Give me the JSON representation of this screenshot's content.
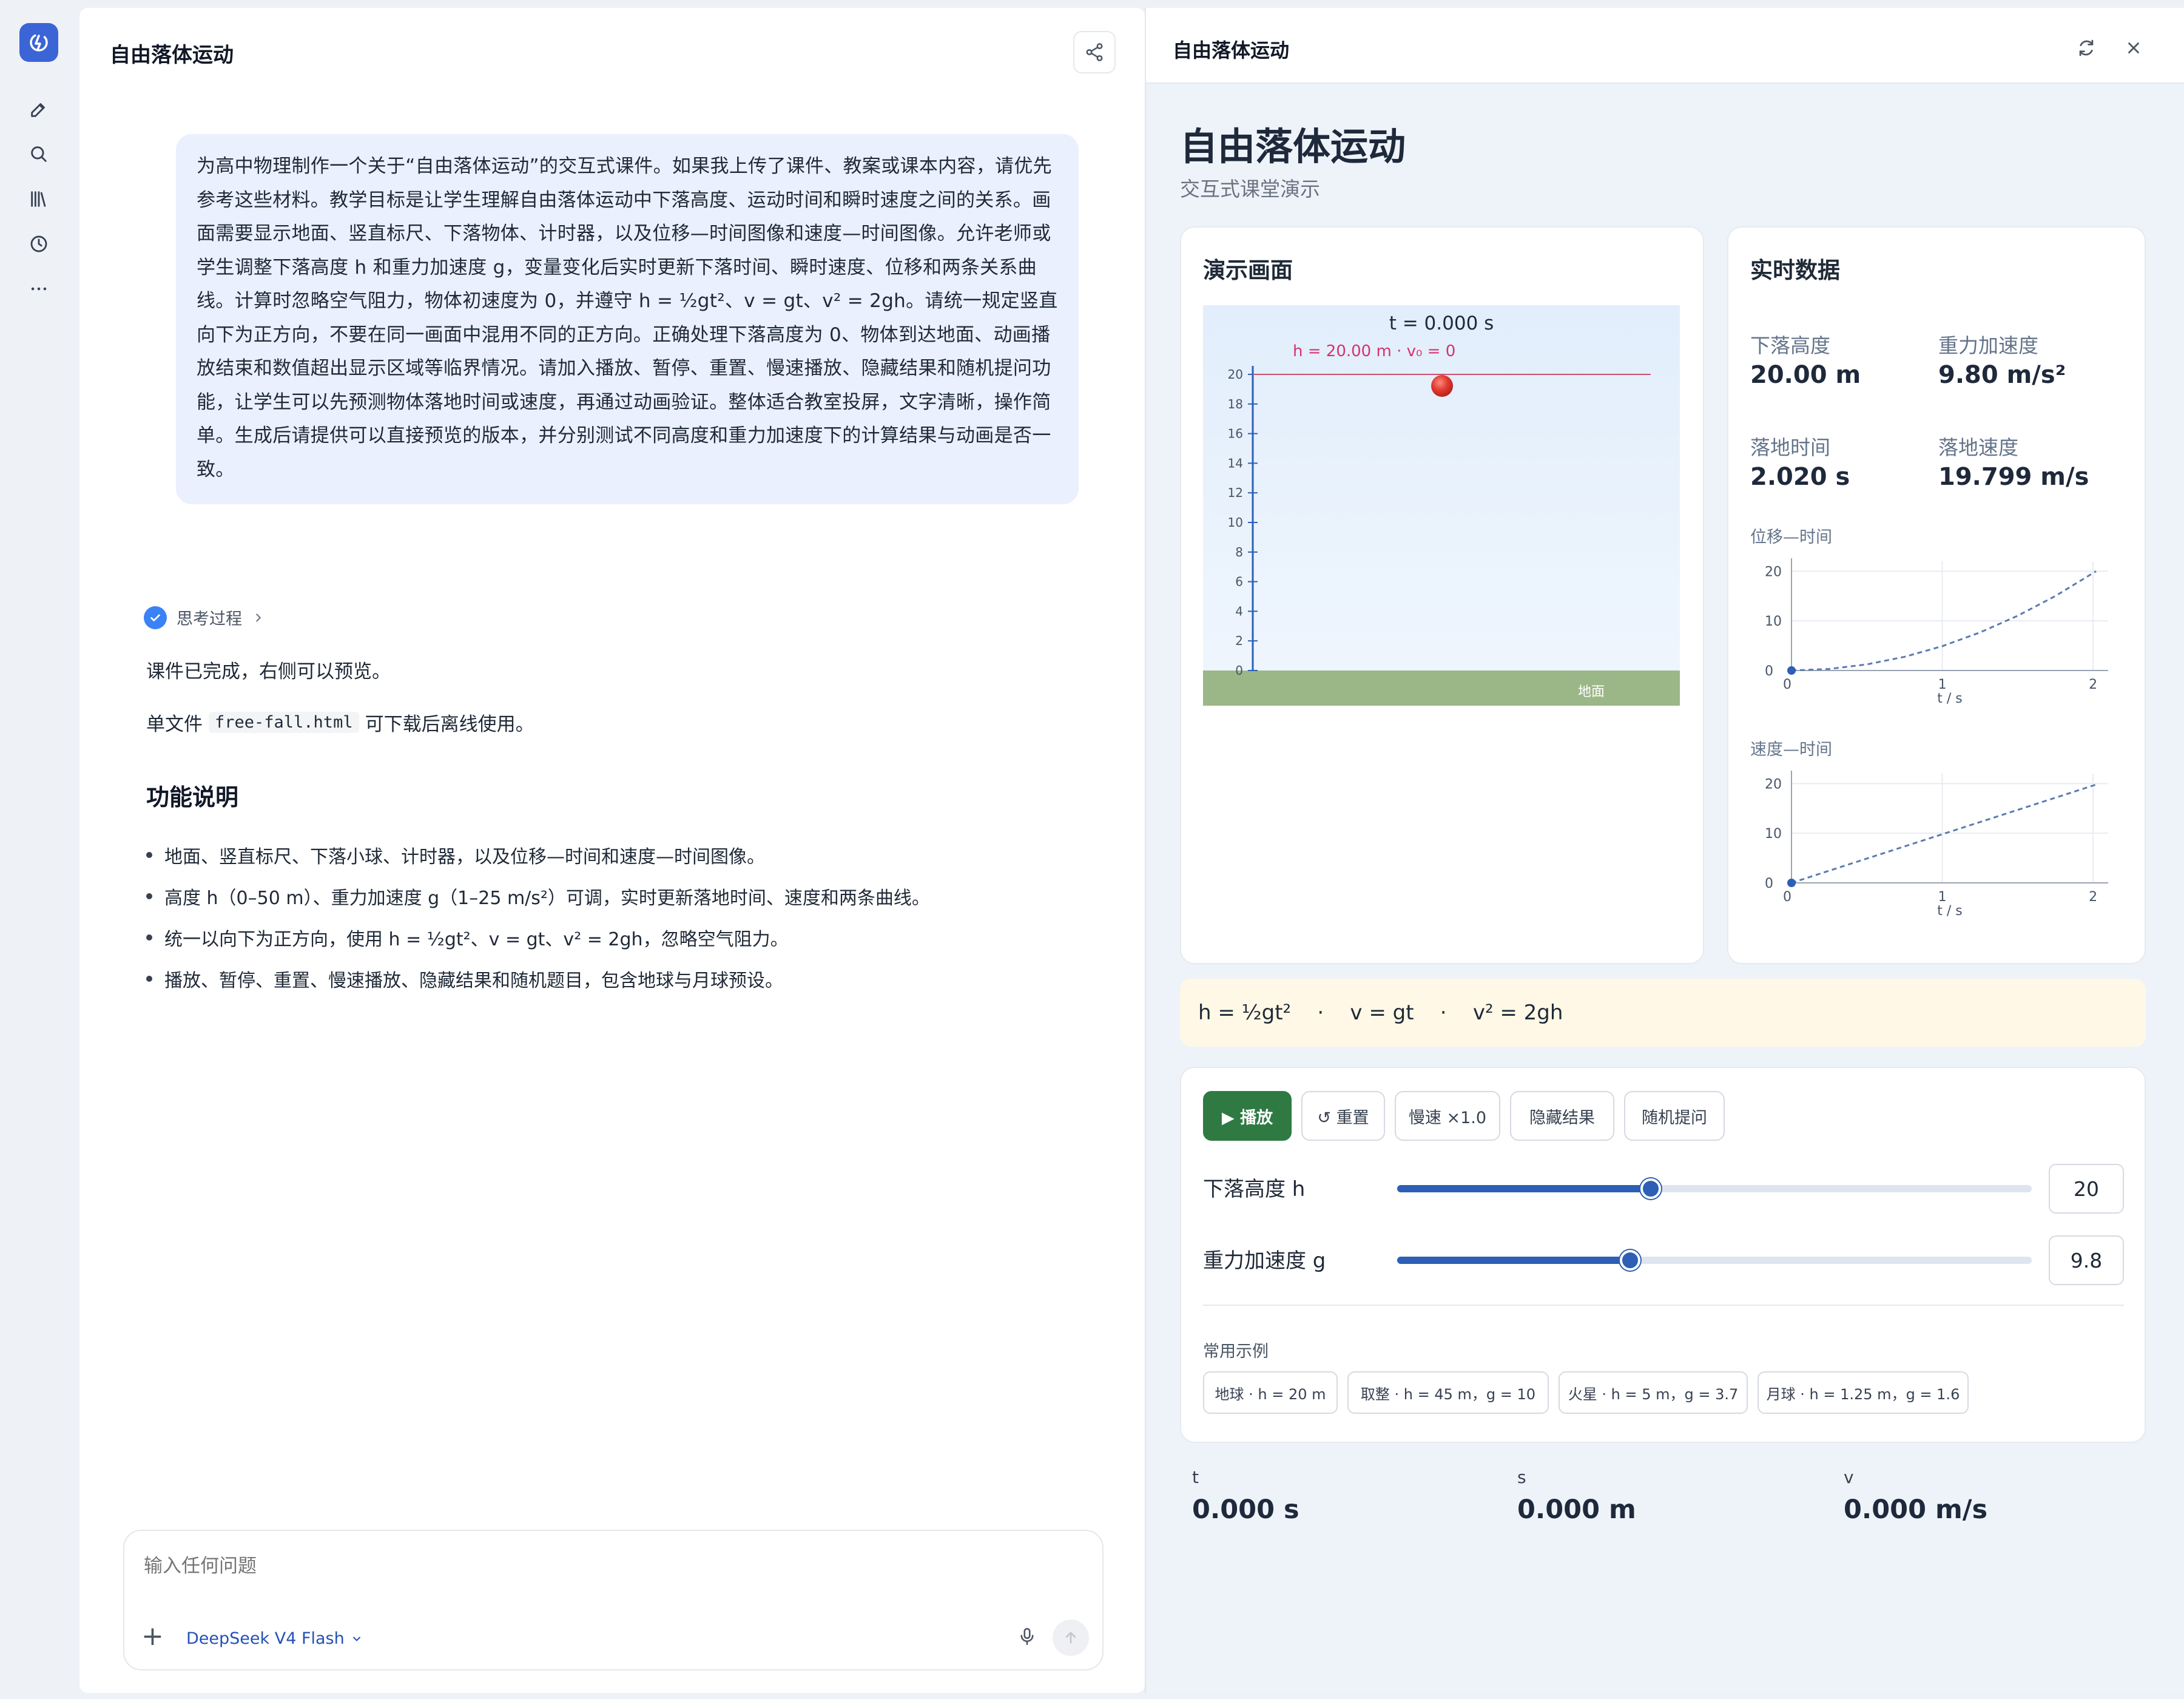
{
  "chat": {
    "title": "自由落体运动",
    "user_message": "为高中物理制作一个关于“自由落体运动”的交互式课件。如果我上传了课件、教案或课本内容，请优先参考这些材料。教学目标是让学生理解自由落体运动中下落高度、运动时间和瞬时速度之间的关系。画面需要显示地面、竖直标尺、下落物体、计时器，以及位移—时间图像和速度—时间图像。允许老师或学生调整下落高度 h 和重力加速度 g，变量变化后实时更新下落时间、瞬时速度、位移和两条关系曲线。计算时忽略空气阻力，物体初速度为 0，并遵守 h = ½gt²、v = gt、v² = 2gh。请统一规定竖直向下为正方向，不要在同一画面中混用不同的正方向。正确处理下落高度为 0、物体到达地面、动画播放结束和数值超出显示区域等临界情况。请加入播放、暂停、重置、慢速播放、隐藏结果和随机提问功能，让学生可以先预测物体落地时间或速度，再通过动画验证。整体适合教室投屏，文字清晰，操作简单。生成后请提供可以直接预览的版本，并分别测试不同高度和重力加速度下的计算结果与动画是否一致。",
    "thinking_label": "思考过程",
    "answer_line1": "课件已完成，右侧可以预览。",
    "answer_line2_pre": "单文件",
    "answer_code": "free-fall.html",
    "answer_line2_post": "可下载后离线使用。",
    "features_heading": "功能说明",
    "features": [
      "地面、竖直标尺、下落小球、计时器，以及位移—时间和速度—时间图像。",
      "高度 h（0–50 m）、重力加速度 g（1–25 m/s²）可调，实时更新落地时间、速度和两条曲线。",
      "统一以向下为正方向，使用 h = ½gt²、v = gt、v² = 2gh，忽略空气阻力。",
      "播放、暂停、重置、慢速播放、隐藏结果和随机题目，包含地球与月球预设。"
    ],
    "input_placeholder": "输入任何问题",
    "model_name": "DeepSeek V4 Flash"
  },
  "preview": {
    "title": "自由落体运动",
    "courseware_title": "自由落体运动",
    "courseware_subtitle": "交互式课堂演示",
    "demo": {
      "heading": "演示画面",
      "timer": "t = 0.000 s",
      "height_tag": "h = 20.00 m · v₀ = 0",
      "ground_label": "地面",
      "ruler_ticks": [
        "0",
        "2",
        "4",
        "6",
        "8",
        "10",
        "12",
        "14",
        "16",
        "18",
        "20"
      ]
    },
    "stats": {
      "heading": "实时数据",
      "height_label": "下落高度",
      "height_value": "20.00 m",
      "g_label": "重力加速度",
      "g_value": "9.80 m/s²",
      "time_label": "落地时间",
      "time_value": "2.020 s",
      "speed_label": "落地速度",
      "speed_value": "19.799 m/s"
    },
    "st_chart": {
      "label": "位移—时间",
      "y_ticks": [
        "20",
        "10",
        "0"
      ],
      "x_ticks": [
        "1",
        "2"
      ],
      "x_label": "t / s"
    },
    "vt_chart": {
      "label": "速度—时间",
      "y_ticks": [
        "20",
        "10",
        "0"
      ],
      "x_ticks": [
        "1",
        "2"
      ],
      "x_label": "t / s"
    },
    "formula": "h = ½gt²    ·    v = gt    ·    v² = 2gh",
    "controls": {
      "play": "▶ 播放",
      "reset": "↺ 重置",
      "slow": "慢速 ×1.0",
      "hide": "隐藏结果",
      "quiz": "随机提问",
      "h_label": "下落高度 h",
      "h_value": "20",
      "h_fraction": 0.4,
      "g_label": "重力加速度 g",
      "g_value": "9.8",
      "g_fraction": 0.367,
      "examples_label": "常用示例",
      "examples": [
        "地球 · h = 20 m",
        "取整 · h = 45 m，g = 10",
        "火星 · h = 5 m，g = 3.7",
        "月球 · h = 1.25 m，g = 1.6"
      ]
    },
    "readouts": {
      "t_label": "t",
      "t_value": "0.000 s",
      "s_label": "s",
      "s_value": "0.000 m",
      "v_label": "v",
      "v_value": "0.000 m/s"
    },
    "colors": {
      "accent": "#2c5fb5",
      "play_green": "#2f7a43",
      "ground": "#9cb787",
      "ball": "#e23a32",
      "height_line": "#c9506d"
    }
  },
  "chart_data": [
    {
      "type": "line",
      "title": "位移—时间",
      "xlabel": "t / s",
      "ylabel": "",
      "x": [
        0,
        0.25,
        0.5,
        0.75,
        1.0,
        1.25,
        1.5,
        1.75,
        2.02
      ],
      "series": [
        {
          "values": [
            0,
            0.31,
            1.23,
            2.76,
            4.9,
            7.66,
            11.03,
            15.01,
            20.0
          ]
        }
      ],
      "xlim": [
        0,
        2.1
      ],
      "ylim": [
        0,
        22
      ],
      "x_ticks": [
        0,
        1,
        2
      ],
      "y_ticks": [
        0,
        10,
        20
      ],
      "grid": true
    },
    {
      "type": "line",
      "title": "速度—时间",
      "xlabel": "t / s",
      "ylabel": "",
      "x": [
        0,
        0.5,
        1.0,
        1.5,
        2.02
      ],
      "series": [
        {
          "values": [
            0,
            4.9,
            9.8,
            14.7,
            19.8
          ]
        }
      ],
      "xlim": [
        0,
        2.1
      ],
      "ylim": [
        0,
        22
      ],
      "x_ticks": [
        0,
        1,
        2
      ],
      "y_ticks": [
        0,
        10,
        20
      ],
      "grid": true
    }
  ]
}
